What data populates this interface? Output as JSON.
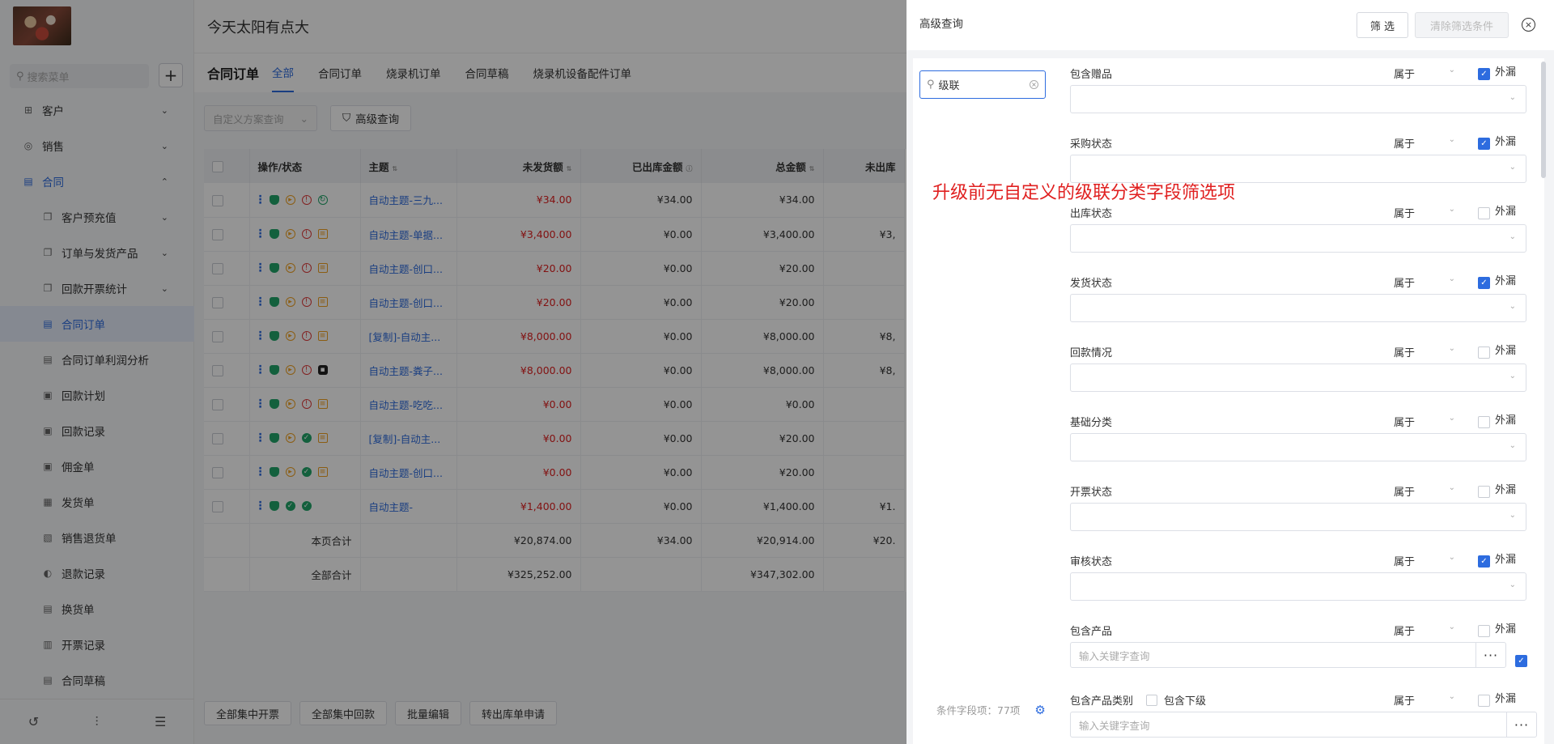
{
  "sidebar": {
    "search_placeholder": "搜索菜单",
    "add_label": "+",
    "items": [
      {
        "label": "客户",
        "icon": "customer-icon",
        "glyph": "⊞",
        "level": "top",
        "chevron": "⌄",
        "state": ""
      },
      {
        "label": "销售",
        "icon": "sales-icon",
        "glyph": "◎",
        "level": "top",
        "chevron": "⌄",
        "state": ""
      },
      {
        "label": "合同",
        "icon": "contract-icon",
        "glyph": "▤",
        "level": "top",
        "chevron": "⌃",
        "state": "open"
      },
      {
        "label": "客户预充值",
        "icon": "copy-icon",
        "glyph": "❐",
        "level": "sub",
        "chevron": "⌄",
        "state": ""
      },
      {
        "label": "订单与发货产品",
        "icon": "copy-icon",
        "glyph": "❐",
        "level": "sub",
        "chevron": "⌄",
        "state": ""
      },
      {
        "label": "回款开票统计",
        "icon": "copy-icon",
        "glyph": "❐",
        "level": "sub",
        "chevron": "⌄",
        "state": ""
      },
      {
        "label": "合同订单",
        "icon": "document-icon",
        "glyph": "▤",
        "level": "sub",
        "chevron": "",
        "state": "active"
      },
      {
        "label": "合同订单利润分析",
        "icon": "document-icon",
        "glyph": "▤",
        "level": "sub",
        "chevron": "",
        "state": ""
      },
      {
        "label": "回款计划",
        "icon": "plan-icon",
        "glyph": "▣",
        "level": "sub",
        "chevron": "",
        "state": ""
      },
      {
        "label": "回款记录",
        "icon": "record-icon",
        "glyph": "▣",
        "level": "sub",
        "chevron": "",
        "state": ""
      },
      {
        "label": "佣金单",
        "icon": "commission-icon",
        "glyph": "▣",
        "level": "sub",
        "chevron": "",
        "state": ""
      },
      {
        "label": "发货单",
        "icon": "delivery-icon",
        "glyph": "▦",
        "level": "sub",
        "chevron": "",
        "state": ""
      },
      {
        "label": "销售退货单",
        "icon": "return-icon",
        "glyph": "▧",
        "level": "sub",
        "chevron": "",
        "state": ""
      },
      {
        "label": "退款记录",
        "icon": "refund-icon",
        "glyph": "◐",
        "level": "sub",
        "chevron": "",
        "state": ""
      },
      {
        "label": "换货单",
        "icon": "exchange-icon",
        "glyph": "▤",
        "level": "sub",
        "chevron": "",
        "state": ""
      },
      {
        "label": "开票记录",
        "icon": "invoice-icon",
        "glyph": "▥",
        "level": "sub",
        "chevron": "",
        "state": ""
      },
      {
        "label": "合同草稿",
        "icon": "draft-icon",
        "glyph": "▤",
        "level": "sub",
        "chevron": "",
        "state": ""
      }
    ],
    "bottom_icons": [
      {
        "icon": "history-icon",
        "glyph": "↺"
      },
      {
        "icon": "settings-sliders-icon",
        "glyph": "⫶"
      },
      {
        "icon": "collapse-menu-icon",
        "glyph": "☰"
      }
    ]
  },
  "header": {
    "title": "今天太阳有点大"
  },
  "tabbar": {
    "title": "合同订单",
    "tabs": [
      {
        "label": "全部",
        "active": true
      },
      {
        "label": "合同订单",
        "active": false
      },
      {
        "label": "烧录机订单",
        "active": false
      },
      {
        "label": "合同草稿",
        "active": false
      },
      {
        "label": "烧录机设备配件订单",
        "active": false
      }
    ]
  },
  "toolbar": {
    "scheme_placeholder": "自定义方案查询",
    "advanced_label": "高级查询"
  },
  "table": {
    "columns": [
      "操作/状态",
      "主题",
      "未发货额",
      "已出库金额",
      "总金额",
      "未出库"
    ],
    "rows": [
      {
        "ops": [
          "dots",
          "person",
          "play",
          "warn",
          "sync"
        ],
        "subject": "自动主题-三九...",
        "unshipped": "¥34.00",
        "red": true,
        "outbound": "¥34.00",
        "total": "¥34.00",
        "not_out": ""
      },
      {
        "ops": [
          "dots",
          "person",
          "play",
          "warn",
          "doc"
        ],
        "subject": "自动主题-单据...",
        "unshipped": "¥3,400.00",
        "red": true,
        "outbound": "¥0.00",
        "total": "¥3,400.00",
        "not_out": "¥3,"
      },
      {
        "ops": [
          "dots",
          "person",
          "play",
          "warn",
          "doc"
        ],
        "subject": "自动主题-创口...",
        "unshipped": "¥20.00",
        "red": true,
        "outbound": "¥0.00",
        "total": "¥20.00",
        "not_out": ""
      },
      {
        "ops": [
          "dots",
          "person",
          "play",
          "warn",
          "doc"
        ],
        "subject": "自动主题-创口...",
        "unshipped": "¥20.00",
        "red": true,
        "outbound": "¥0.00",
        "total": "¥20.00",
        "not_out": ""
      },
      {
        "ops": [
          "dots",
          "person",
          "play",
          "warn",
          "doc"
        ],
        "subject": "[复制]-自动主...",
        "unshipped": "¥8,000.00",
        "red": true,
        "outbound": "¥0.00",
        "total": "¥8,000.00",
        "not_out": "¥8,"
      },
      {
        "ops": [
          "dots",
          "person",
          "play",
          "warn",
          "black"
        ],
        "subject": "自动主题-粪子...",
        "unshipped": "¥8,000.00",
        "red": true,
        "outbound": "¥0.00",
        "total": "¥8,000.00",
        "not_out": "¥8,"
      },
      {
        "ops": [
          "dots",
          "person",
          "play",
          "warn",
          "doc"
        ],
        "subject": "自动主题-吃吃...",
        "unshipped": "¥0.00",
        "red": true,
        "outbound": "¥0.00",
        "total": "¥0.00",
        "not_out": ""
      },
      {
        "ops": [
          "dots",
          "person",
          "play",
          "ok",
          "doc"
        ],
        "subject": "[复制]-自动主...",
        "unshipped": "¥0.00",
        "red": true,
        "outbound": "¥0.00",
        "total": "¥20.00",
        "not_out": ""
      },
      {
        "ops": [
          "dots",
          "person",
          "play",
          "ok",
          "doc"
        ],
        "subject": "自动主题-创口...",
        "unshipped": "¥0.00",
        "red": true,
        "outbound": "¥0.00",
        "total": "¥20.00",
        "not_out": ""
      },
      {
        "ops": [
          "dots",
          "person",
          "ok",
          "ok"
        ],
        "subject": "自动主题-",
        "unshipped": "¥1,400.00",
        "red": true,
        "outbound": "¥0.00",
        "total": "¥1,400.00",
        "not_out": "¥1."
      }
    ],
    "page_total": {
      "label": "本页合计",
      "unshipped": "¥20,874.00",
      "outbound": "¥34.00",
      "total": "¥20,914.00",
      "not_out": "¥20."
    },
    "all_total": {
      "label": "全部合计",
      "unshipped": "¥325,252.00",
      "outbound": "",
      "total": "¥347,302.00",
      "not_out": ""
    }
  },
  "bottom_actions": [
    "全部集中开票",
    "全部集中回款",
    "批量编辑",
    "转出库单申请"
  ],
  "drawer": {
    "title": "高级查询",
    "filter_label": "筛 选",
    "clear_label": "清除筛选条件",
    "close_glyph": "×",
    "search_value": "级联",
    "count_label": "条件字段项：77项",
    "fields": [
      {
        "label": "包含赠品",
        "operator": "属于",
        "exclude_label": "外漏",
        "exclude_checked": true,
        "kind": "select"
      },
      {
        "label": "采购状态",
        "operator": "属于",
        "exclude_label": "外漏",
        "exclude_checked": true,
        "kind": "select"
      },
      {
        "label": "出库状态",
        "operator": "属于",
        "exclude_label": "外漏",
        "exclude_checked": false,
        "kind": "select"
      },
      {
        "label": "发货状态",
        "operator": "属于",
        "exclude_label": "外漏",
        "exclude_checked": true,
        "kind": "select"
      },
      {
        "label": "回款情况",
        "operator": "属于",
        "exclude_label": "外漏",
        "exclude_checked": false,
        "kind": "select"
      },
      {
        "label": "基础分类",
        "operator": "属于",
        "exclude_label": "外漏",
        "exclude_checked": false,
        "kind": "select"
      },
      {
        "label": "开票状态",
        "operator": "属于",
        "exclude_label": "外漏",
        "exclude_checked": false,
        "kind": "select"
      },
      {
        "label": "审核状态",
        "operator": "属于",
        "exclude_label": "外漏",
        "exclude_checked": true,
        "kind": "select"
      },
      {
        "label": "包含产品",
        "operator": "属于",
        "exclude_label": "外漏",
        "exclude_checked": false,
        "kind": "input",
        "placeholder": "输入关键字查询",
        "more": "···",
        "extra_checked": true
      },
      {
        "label": "包含产品类别",
        "sub_label": "包含下级",
        "operator": "属于",
        "exclude_label": "外漏",
        "exclude_checked": false,
        "kind": "input",
        "placeholder": "输入关键字查询",
        "more": "···"
      }
    ]
  },
  "annotation": "升级前无自定义的级联分类字段筛选项",
  "colors": {
    "accent": "#2d6cdf",
    "danger": "#e02020",
    "success": "#21a56a",
    "warning": "#f0a020"
  }
}
